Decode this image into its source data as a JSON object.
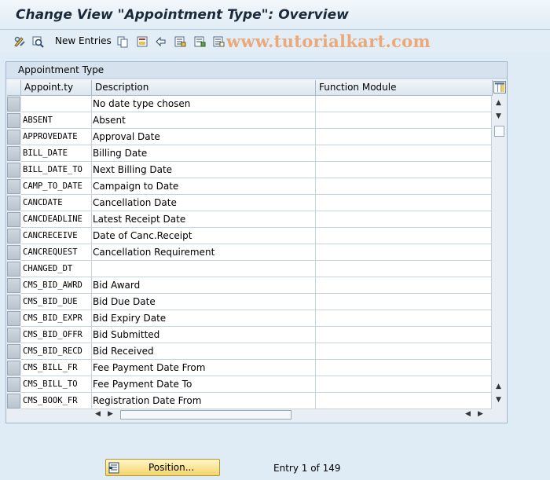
{
  "window": {
    "title": "Change View \"Appointment Type\": Overview"
  },
  "toolbar": {
    "new_entries_label": "New Entries",
    "icons": [
      "display-change-icon",
      "other-view-icon",
      "copy-icon",
      "save-delete-icon",
      "undo-icon",
      "select-all-icon",
      "select-block-icon",
      "deselect-all-icon"
    ]
  },
  "watermark": "www.tutorialkart.com",
  "table": {
    "title": "Appointment Type",
    "columns": [
      "Appoint.ty",
      "Description",
      "Function Module"
    ],
    "rows": [
      {
        "appoint_ty": "",
        "description": "No date type chosen",
        "function_module": ""
      },
      {
        "appoint_ty": "ABSENT",
        "description": "Absent",
        "function_module": ""
      },
      {
        "appoint_ty": "APPROVEDATE",
        "description": "Approval Date",
        "function_module": ""
      },
      {
        "appoint_ty": "BILL_DATE",
        "description": "Billing Date",
        "function_module": ""
      },
      {
        "appoint_ty": "BILL_DATE_TO",
        "description": "Next Billing Date",
        "function_module": ""
      },
      {
        "appoint_ty": "CAMP_TO_DATE",
        "description": "Campaign to Date",
        "function_module": ""
      },
      {
        "appoint_ty": "CANCDATE",
        "description": "Cancellation Date",
        "function_module": ""
      },
      {
        "appoint_ty": "CANCDEADLINE",
        "description": "Latest Receipt Date",
        "function_module": ""
      },
      {
        "appoint_ty": "CANCRECEIVE",
        "description": "Date of Canc.Receipt",
        "function_module": ""
      },
      {
        "appoint_ty": "CANCREQUEST",
        "description": "Cancellation Requirement",
        "function_module": ""
      },
      {
        "appoint_ty": "CHANGED_DT",
        "description": "",
        "function_module": ""
      },
      {
        "appoint_ty": "CMS_BID_AWRD",
        "description": "Bid Award",
        "function_module": ""
      },
      {
        "appoint_ty": "CMS_BID_DUE",
        "description": "Bid Due Date",
        "function_module": ""
      },
      {
        "appoint_ty": "CMS_BID_EXPR",
        "description": "Bid Expiry Date",
        "function_module": ""
      },
      {
        "appoint_ty": "CMS_BID_OFFR",
        "description": "Bid Submitted",
        "function_module": ""
      },
      {
        "appoint_ty": "CMS_BID_RECD",
        "description": "Bid Received",
        "function_module": ""
      },
      {
        "appoint_ty": "CMS_BILL_FR",
        "description": "Fee Payment Date From",
        "function_module": ""
      },
      {
        "appoint_ty": "CMS_BILL_TO",
        "description": "Fee Payment Date To",
        "function_module": ""
      },
      {
        "appoint_ty": "CMS_BOOK_FR",
        "description": "Registration Date From",
        "function_module": ""
      }
    ]
  },
  "footer": {
    "position_button_label": "Position...",
    "entry_info": "Entry 1 of 149"
  },
  "colors": {
    "accent_button": "#f5d56a",
    "background": "#dfebf5",
    "watermark": "#eaa97a"
  }
}
